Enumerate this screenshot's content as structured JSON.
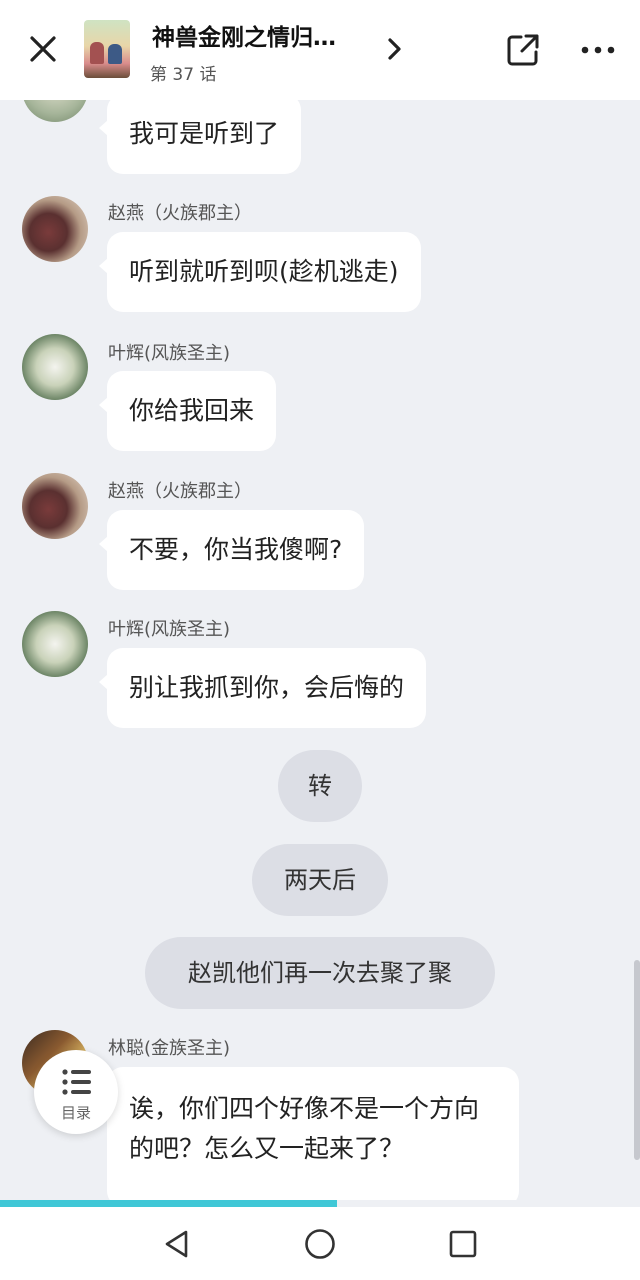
{
  "header": {
    "title": "神兽金刚之情归…",
    "episode": "第 37 话"
  },
  "messages": [
    {
      "sender": "",
      "text": "我可是听到了"
    },
    {
      "sender": "赵燕（火族郡主）",
      "text": "听到就听到呗(趁机逃走)"
    },
    {
      "sender": "叶辉(风族圣主)",
      "text": "你给我回来"
    },
    {
      "sender": "赵燕（火族郡主）",
      "text": "不要，你当我傻啊?"
    },
    {
      "sender": "叶辉(风族圣主)",
      "text": "别让我抓到你，会后悔的"
    },
    {
      "sender": "林聪(金族圣主)",
      "text": "诶，你们四个好像不是一个方向的吧？怎么又一起来了？"
    }
  ],
  "narration": [
    "转",
    "两天后",
    "赵凯他们再一次去聚了聚"
  ],
  "toc": {
    "label": "目录"
  },
  "progress": {
    "fraction": 0.527
  },
  "colors": {
    "accent": "#3fc7d6",
    "background": "#eef0f4",
    "bubble": "#ffffff",
    "narration": "#dcdee5"
  },
  "icons": [
    "close-icon",
    "chevron-right-icon",
    "share-icon",
    "more-icon",
    "list-icon",
    "back-icon",
    "home-icon",
    "recent-apps-icon"
  ]
}
